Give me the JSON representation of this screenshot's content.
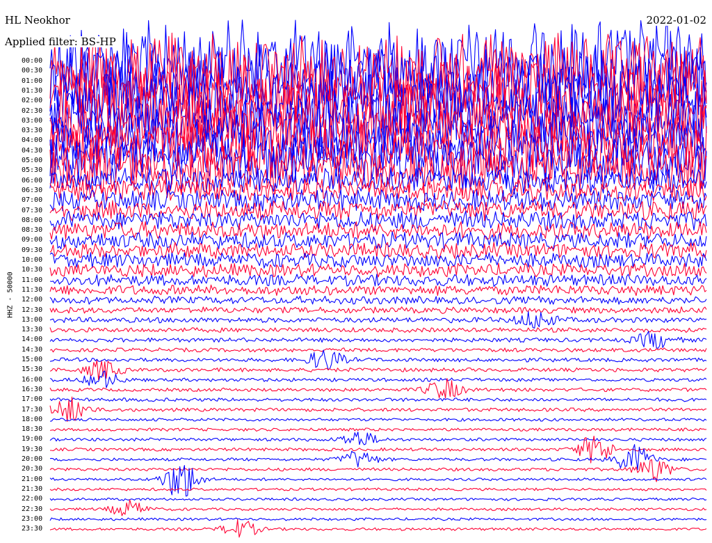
{
  "header": {
    "station": "HL Neokhor",
    "date": "2022-01-02",
    "filter_text": "Applied filter: BS-HP"
  },
  "channel_label": "HHZ - 50000",
  "colors": {
    "trace_a": "#0000ff",
    "trace_b": "#ff0033",
    "background": "#ffffff"
  },
  "chart_data": {
    "type": "line",
    "title": "",
    "xlabel": "",
    "ylabel": "HHZ - 50000",
    "row_labels": [
      "00:00",
      "00:30",
      "01:00",
      "01:30",
      "02:00",
      "02:30",
      "03:00",
      "03:30",
      "04:00",
      "04:30",
      "05:00",
      "05:30",
      "06:00",
      "06:30",
      "07:00",
      "07:30",
      "08:00",
      "08:30",
      "09:00",
      "09:30",
      "10:00",
      "10:30",
      "11:00",
      "11:30",
      "12:00",
      "12:30",
      "13:00",
      "13:30",
      "14:00",
      "14:30",
      "15:00",
      "15:30",
      "16:00",
      "16:30",
      "17:00",
      "17:30",
      "18:00",
      "18:30",
      "19:00",
      "19:30",
      "20:00",
      "20:30",
      "21:00",
      "21:30",
      "22:00",
      "22:30",
      "23:00",
      "23:30"
    ],
    "row_amplitude": [
      10,
      9.5,
      9,
      9,
      8.5,
      8.5,
      8,
      8,
      7.5,
      7,
      6.5,
      6,
      3.2,
      2.9,
      2.7,
      2.5,
      2.4,
      2.2,
      2.1,
      2,
      1.9,
      1.7,
      1.5,
      1.3,
      1,
      0.8,
      0.7,
      0.6,
      0.55,
      0.5,
      0.5,
      0.5,
      0.45,
      0.45,
      0.45,
      0.45,
      0.4,
      0.4,
      0.4,
      0.4,
      0.4,
      0.4,
      0.35,
      0.35,
      0.35,
      0.35,
      0.35,
      0.35
    ],
    "series": [
      {
        "color": "#0000ff",
        "rows": "even"
      },
      {
        "color": "#ff0033",
        "rows": "odd"
      }
    ],
    "events": [
      {
        "row": 31,
        "t": 0.08,
        "amp": 2.2
      },
      {
        "row": 32,
        "t": 0.08,
        "amp": 2.0
      },
      {
        "row": 35,
        "t": 0.03,
        "amp": 3.0
      },
      {
        "row": 42,
        "t": 0.2,
        "amp": 5.0
      },
      {
        "row": 40,
        "t": 0.47,
        "amp": 2.0
      },
      {
        "row": 38,
        "t": 0.47,
        "amp": 2.0
      },
      {
        "row": 39,
        "t": 0.83,
        "amp": 3.5
      },
      {
        "row": 40,
        "t": 0.89,
        "amp": 3.5
      },
      {
        "row": 41,
        "t": 0.92,
        "amp": 3.0
      },
      {
        "row": 30,
        "t": 0.42,
        "amp": 2.5
      },
      {
        "row": 26,
        "t": 0.74,
        "amp": 2.0
      },
      {
        "row": 28,
        "t": 0.92,
        "amp": 2.0
      },
      {
        "row": 33,
        "t": 0.6,
        "amp": 2.5
      },
      {
        "row": 47,
        "t": 0.29,
        "amp": 2.2
      },
      {
        "row": 45,
        "t": 0.12,
        "amp": 2.0
      }
    ]
  }
}
